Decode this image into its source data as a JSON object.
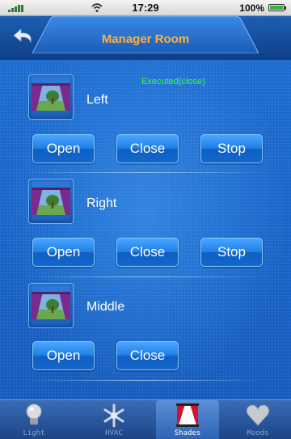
{
  "status_bar": {
    "time": "17:29",
    "battery": "100%"
  },
  "header": {
    "title": "Manager Room"
  },
  "status_message": "Executed(close)",
  "devices": [
    {
      "name": "Left",
      "buttons": [
        "Open",
        "Close",
        "Stop"
      ]
    },
    {
      "name": "Right",
      "buttons": [
        "Open",
        "Close",
        "Stop"
      ]
    },
    {
      "name": "Middle",
      "buttons": [
        "Open",
        "Close"
      ]
    }
  ],
  "tabs": [
    {
      "label": "Light",
      "icon": "bulb-icon"
    },
    {
      "label": "HVAC",
      "icon": "snowflake-icon"
    },
    {
      "label": "Shades",
      "icon": "curtain-icon",
      "active": true
    },
    {
      "label": "Moods",
      "icon": "heart-icon"
    }
  ],
  "colors": {
    "title": "#ffb13b",
    "status_message": "#3dff3d",
    "accent": "#1f7fe6"
  }
}
